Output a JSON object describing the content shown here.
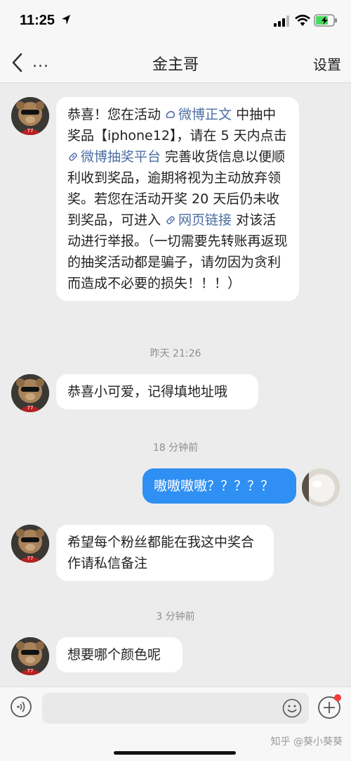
{
  "status_bar": {
    "time": "11:25",
    "icons": [
      "location-arrow-icon",
      "signal-icon",
      "wifi-icon",
      "battery-charging-icon"
    ]
  },
  "nav": {
    "back_icon": "chevron-left-icon",
    "more_label": "...",
    "title": "金主哥",
    "settings_label": "设置"
  },
  "messages": {
    "m1": {
      "t1": "恭喜！您在活动 ",
      "link1": "微博正文",
      "t2": " 中抽中奖品【iphone12】，请在 5 天内点击 ",
      "link2": "微博抽奖平台",
      "t3": " 完善收货信息以便顺利收到奖品，逾期将视为主动放弃领奖。若您在活动开奖 20 天后仍未收到奖品，可进入 ",
      "link3": "网页链接",
      "t4": " 对该活动进行举报。（一切需要先转账再返现的抽奖活动都是骗子，请勿因为贪利而造成不必要的损失！！！）"
    },
    "ts1": "昨天 21:26",
    "m2": "恭喜小可爱，记得填地址哦",
    "ts2": "18 分钟前",
    "m3": "嗷嗷嗷嗷？？？？？",
    "m4": "希望每个粉丝都能在我这中奖合作请私信备注",
    "ts3": "3 分钟前",
    "m5": "想要哪个颜色呢"
  },
  "input": {
    "placeholder": "",
    "icons": [
      "voice-icon",
      "emoji-icon",
      "plus-icon"
    ]
  },
  "watermark": "知乎 @葵小葵葵",
  "colors": {
    "outgoing_bubble": "#2f8ff2",
    "incoming_bubble": "#ffffff",
    "background": "#ececec",
    "link": "#4b6ea3",
    "badge": "#f23a3a"
  }
}
